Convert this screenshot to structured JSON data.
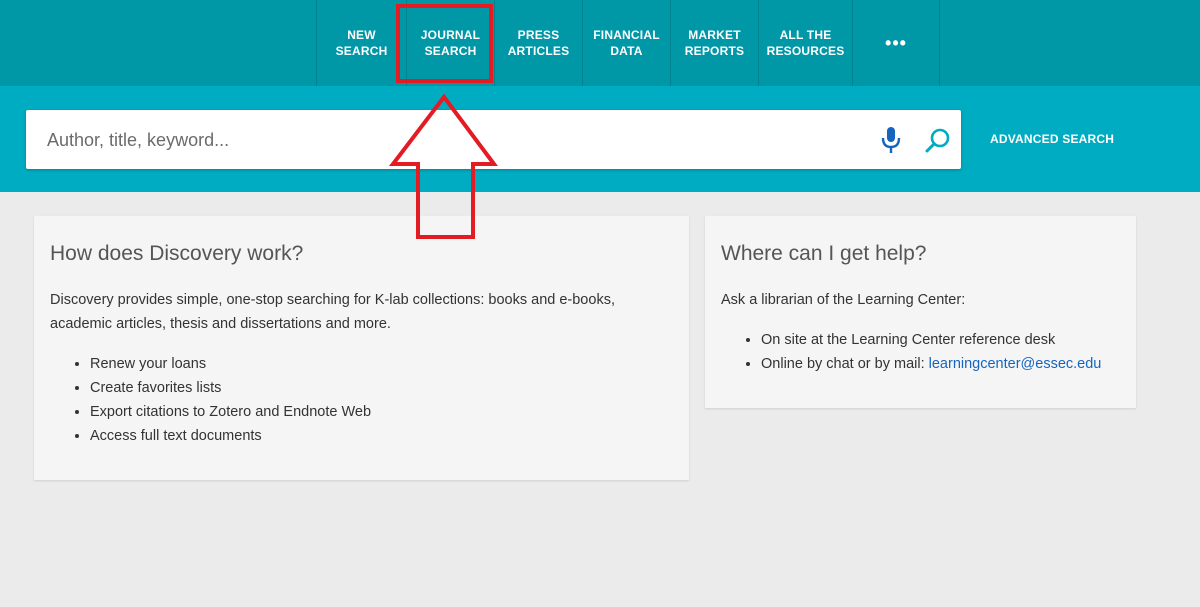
{
  "nav": {
    "items": [
      {
        "line1": "NEW",
        "line2": "SEARCH"
      },
      {
        "line1": "JOURNAL",
        "line2": "SEARCH"
      },
      {
        "line1": "PRESS",
        "line2": "ARTICLES"
      },
      {
        "line1": "FINANCIAL",
        "line2": "DATA"
      },
      {
        "line1": "MARKET",
        "line2": "REPORTS"
      },
      {
        "line1": "ALL THE",
        "line2": "RESOURCES"
      }
    ],
    "more": "•••"
  },
  "search": {
    "placeholder": "Author, title, keyword...",
    "value": "",
    "advanced_label": "ADVANCED SEARCH"
  },
  "icons": {
    "mic": "microphone-icon",
    "search": "magnifier-icon",
    "more": "more-dots-icon"
  },
  "discovery": {
    "title": "How does Discovery work?",
    "description": "Discovery provides simple, one-stop searching for K-lab collections: books and e-books, academic articles, thesis and dissertations and more.",
    "features": [
      "Renew your loans",
      "Create favorites lists",
      "Export citations to Zotero and Endnote Web",
      "Access full text documents"
    ]
  },
  "help": {
    "title": "Where can I get help?",
    "intro": "Ask a librarian of the Learning Center:",
    "items": [
      "On site at the Learning Center reference desk",
      "Online by chat or by mail: "
    ],
    "email": "learningcenter@essec.edu"
  },
  "colors": {
    "nav_bg": "#0097a7",
    "search_band": "#00acc1",
    "mic": "#1565c0",
    "search_icon": "#00acc1",
    "annotation": "#e31b23",
    "link": "#1565c0"
  }
}
